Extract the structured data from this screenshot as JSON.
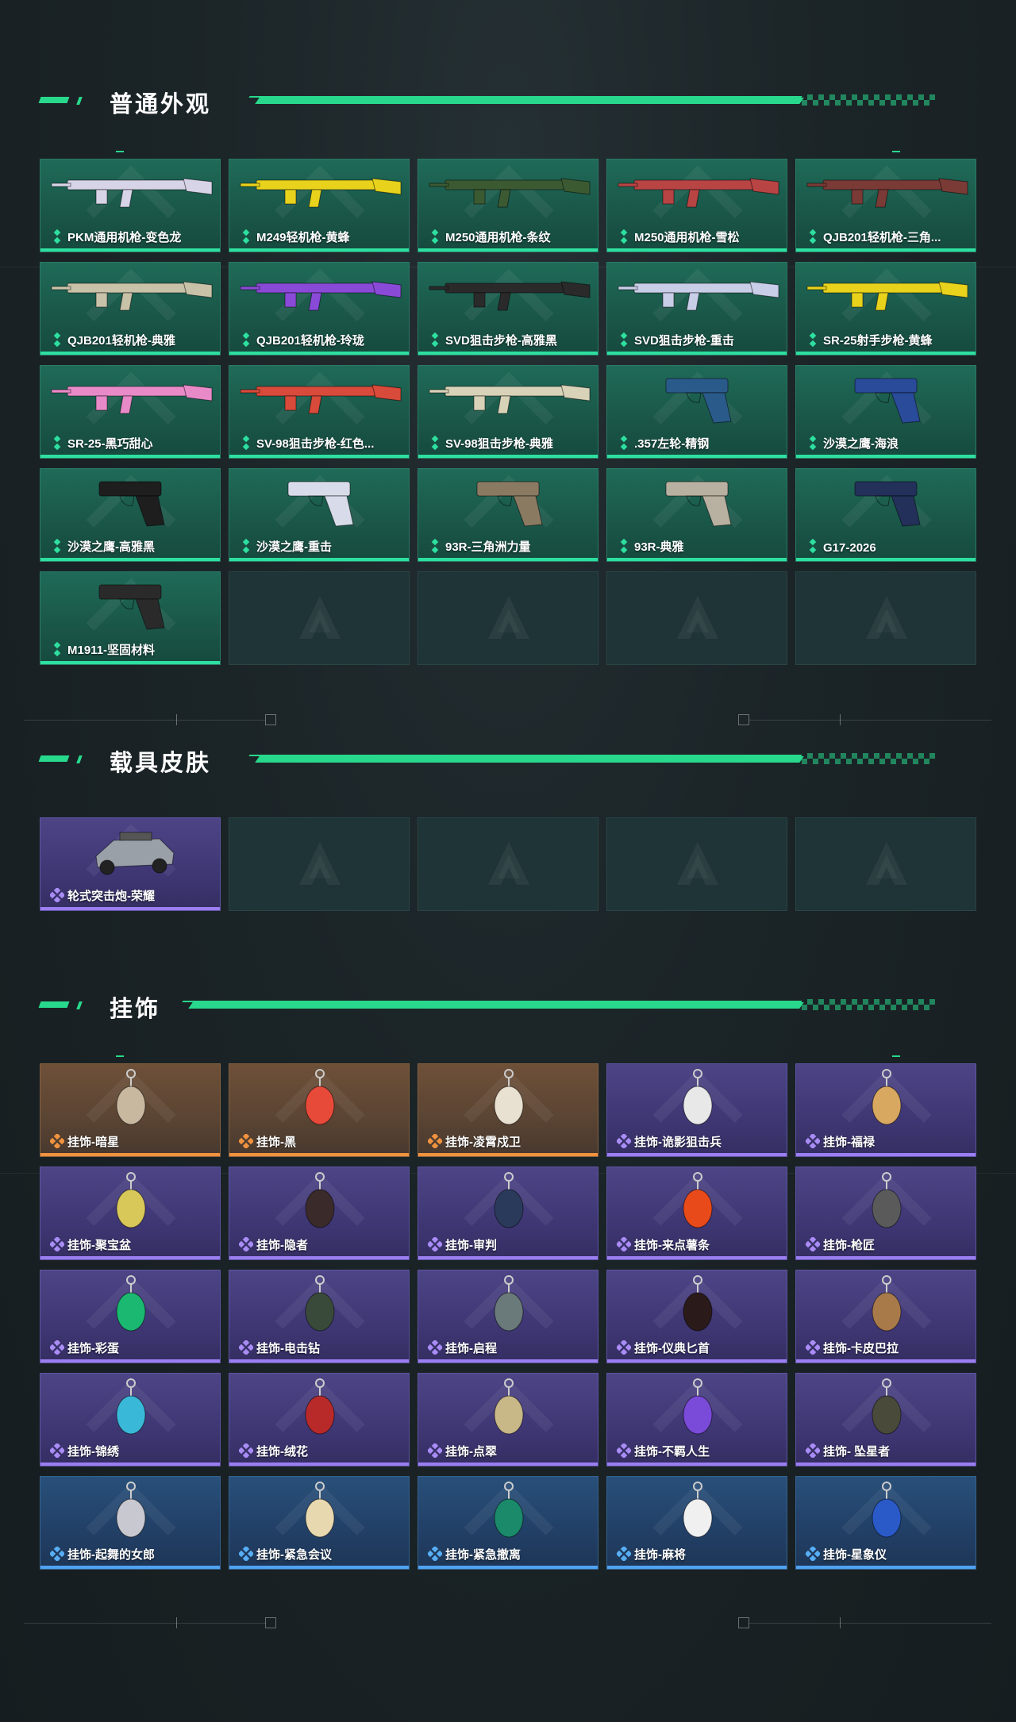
{
  "sections": {
    "weapons": {
      "title": "普通外观",
      "items": [
        {
          "label": "PKM通用机枪-变色龙",
          "color": "#d8d4e8"
        },
        {
          "label": "M249轻机枪-黄蜂",
          "color": "#e8d21c"
        },
        {
          "label": "M250通用机枪-条纹",
          "color": "#3b5a32"
        },
        {
          "label": "M250通用机枪-雪松",
          "color": "#b84444"
        },
        {
          "label": "QJB201轻机枪-三角...",
          "color": "#7a3a36"
        },
        {
          "label": "QJB201轻机枪-典雅",
          "color": "#c8c2a8"
        },
        {
          "label": "QJB201轻机枪-玲珑",
          "color": "#8a4ad8"
        },
        {
          "label": "SVD狙击步枪-高雅黑",
          "color": "#2a2a2a"
        },
        {
          "label": "SVD狙击步枪-重击",
          "color": "#c8cde8"
        },
        {
          "label": "SR-25射手步枪-黄蜂",
          "color": "#e8d21c"
        },
        {
          "label": "SR-25-黑巧甜心",
          "color": "#e88ac8"
        },
        {
          "label": "SV-98狙击步枪-红色...",
          "color": "#d84a3a"
        },
        {
          "label": "SV-98狙击步枪-典雅",
          "color": "#d8d2b8"
        },
        {
          "label": ".357左轮-精钢",
          "color": "#2a5a8a"
        },
        {
          "label": "沙漠之鹰-海浪",
          "color": "#2a4a9a"
        },
        {
          "label": "沙漠之鹰-高雅黑",
          "color": "#1e1e1e"
        },
        {
          "label": "沙漠之鹰-重击",
          "color": "#d8dcea"
        },
        {
          "label": "93R-三角洲力量",
          "color": "#8a7a62"
        },
        {
          "label": "93R-典雅",
          "color": "#b8b0a0"
        },
        {
          "label": "G17-2026",
          "color": "#22305a"
        },
        {
          "label": "M1911-坚固材料",
          "color": "#2a2a2a"
        }
      ]
    },
    "vehicles": {
      "title": "载具皮肤",
      "items": [
        {
          "label": "轮式突击炮-荣耀",
          "color": "#9aa0a8"
        }
      ]
    },
    "charms": {
      "title": "挂饰",
      "items": [
        {
          "label": "挂饰-暗星",
          "tier": "orange",
          "color": "#c8b8a0"
        },
        {
          "label": "挂饰-黑",
          "tier": "orange",
          "color": "#e84a3a"
        },
        {
          "label": "挂饰-凌霄戍卫",
          "tier": "orange",
          "color": "#e8e0d0"
        },
        {
          "label": "挂饰-诡影狙击兵",
          "tier": "purple",
          "color": "#e8e8e8"
        },
        {
          "label": "挂饰-福禄",
          "tier": "purple",
          "color": "#d8a860"
        },
        {
          "label": "挂饰-聚宝盆",
          "tier": "purple",
          "color": "#d8c85a"
        },
        {
          "label": "挂饰-隐者",
          "tier": "purple",
          "color": "#3a2a2a"
        },
        {
          "label": "挂饰-审判",
          "tier": "purple",
          "color": "#2a3a5a"
        },
        {
          "label": "挂饰-来点薯条",
          "tier": "purple",
          "color": "#e84a1a"
        },
        {
          "label": "挂饰-枪匠",
          "tier": "purple",
          "color": "#5a5a5a"
        },
        {
          "label": "挂饰-彩蛋",
          "tier": "purple",
          "color": "#1ab870"
        },
        {
          "label": "挂饰-电击钻",
          "tier": "purple",
          "color": "#3a4a3a"
        },
        {
          "label": "挂饰-启程",
          "tier": "purple",
          "color": "#6a7a7a"
        },
        {
          "label": "挂饰-仪典匕首",
          "tier": "purple",
          "color": "#2a1a1a"
        },
        {
          "label": "挂饰-卡皮巴拉",
          "tier": "purple",
          "color": "#a87a4a"
        },
        {
          "label": "挂饰-锦绣",
          "tier": "purple",
          "color": "#3ab8d8"
        },
        {
          "label": "挂饰-绒花",
          "tier": "purple",
          "color": "#b82a2a"
        },
        {
          "label": "挂饰-点翠",
          "tier": "purple",
          "color": "#c8b888"
        },
        {
          "label": "挂饰-不羁人生",
          "tier": "purple",
          "color": "#7a4ad8"
        },
        {
          "label": "挂饰- 坠星者",
          "tier": "purple",
          "color": "#4a4a3a"
        },
        {
          "label": "挂饰-起舞的女郎",
          "tier": "blue",
          "color": "#c8c8d0"
        },
        {
          "label": "挂饰-紧急会议",
          "tier": "blue",
          "color": "#e8d8b0"
        },
        {
          "label": "挂饰-紧急撤离",
          "tier": "blue",
          "color": "#1a8a6a"
        },
        {
          "label": "挂饰-麻将",
          "tier": "blue",
          "color": "#f0f0f0"
        },
        {
          "label": "挂饰-星象仪",
          "tier": "blue",
          "color": "#2a5ac8"
        }
      ]
    }
  }
}
